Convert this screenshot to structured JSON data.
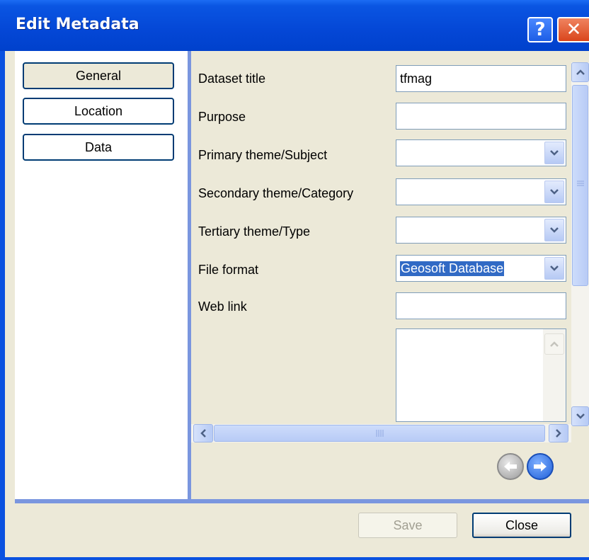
{
  "window": {
    "title": "Edit Metadata",
    "help_glyph": "?",
    "close_glyph": "✕"
  },
  "sidebar": {
    "items": [
      {
        "label": "General",
        "active": true
      },
      {
        "label": "Location",
        "active": false
      },
      {
        "label": "Data",
        "active": false
      }
    ]
  },
  "form": {
    "dataset_title": {
      "label": "Dataset title",
      "value": "tfmag"
    },
    "purpose": {
      "label": "Purpose",
      "value": ""
    },
    "primary_theme": {
      "label": "Primary theme/Subject",
      "value": ""
    },
    "secondary_theme": {
      "label": "Secondary theme/Category",
      "value": ""
    },
    "tertiary_theme": {
      "label": "Tertiary theme/Type",
      "value": ""
    },
    "file_format": {
      "label": "File format",
      "value": "Geosoft Database"
    },
    "web_link": {
      "label": "Web link",
      "value": ""
    }
  },
  "footer": {
    "save_label": "Save",
    "close_label": "Close"
  },
  "colors": {
    "title_bar": "#0a55e2",
    "panel": "#ece9d8",
    "divider": "#7a96df",
    "selection": "#316ac5"
  }
}
